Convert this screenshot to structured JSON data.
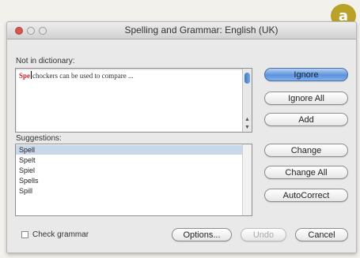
{
  "badge": "a",
  "window": {
    "title": "Spelling and Grammar: English (UK)"
  },
  "not_in_dictionary": {
    "label": "Not in dictionary:",
    "misspelled_word": "Spe",
    "rest_text": "chockers can be used to compare ..."
  },
  "suggestions": {
    "label": "Suggestions:",
    "items": [
      "Spell",
      "Spelt",
      "Spiel",
      "Spells",
      "Spill"
    ],
    "selected_index": 0
  },
  "buttons": {
    "ignore": "Ignore",
    "ignore_all": "Ignore All",
    "add": "Add",
    "change": "Change",
    "change_all": "Change All",
    "autocorrect": "AutoCorrect",
    "options": "Options...",
    "undo": "Undo",
    "cancel": "Cancel"
  },
  "check_grammar": {
    "label": "Check grammar",
    "checked": false
  },
  "colors": {
    "misspelled": "#c8262b",
    "default_button": "#5d92dc",
    "selection": "#c9d7ea",
    "badge": "#b9a227"
  }
}
